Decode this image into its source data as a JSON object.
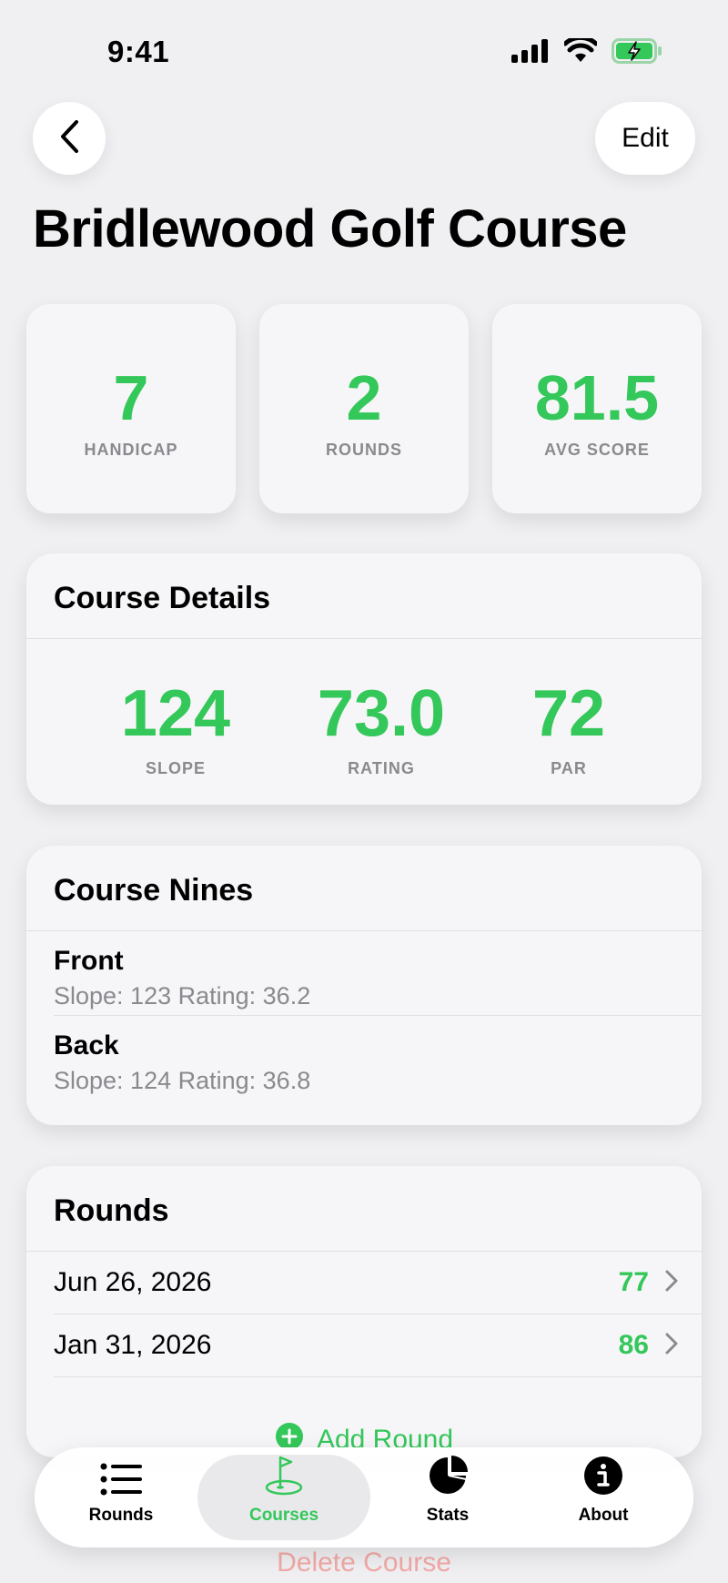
{
  "status_bar": {
    "time": "9:41"
  },
  "nav": {
    "edit_label": "Edit"
  },
  "course": {
    "name": "Bridlewood Golf Course"
  },
  "stats": [
    {
      "value": "7",
      "label": "HANDICAP"
    },
    {
      "value": "2",
      "label": "ROUNDS"
    },
    {
      "value": "81.5",
      "label": "AVG SCORE"
    }
  ],
  "details": {
    "title": "Course Details",
    "items": [
      {
        "value": "124",
        "label": "SLOPE"
      },
      {
        "value": "73.0",
        "label": "RATING"
      },
      {
        "value": "72",
        "label": "PAR"
      }
    ]
  },
  "nines": {
    "title": "Course Nines",
    "items": [
      {
        "name": "Front",
        "meta": "Slope: 123 Rating: 36.2"
      },
      {
        "name": "Back",
        "meta": "Slope: 124 Rating: 36.8"
      }
    ]
  },
  "rounds": {
    "title": "Rounds",
    "items": [
      {
        "date": "Jun 26, 2026",
        "score": "77"
      },
      {
        "date": "Jan 31, 2026",
        "score": "86"
      }
    ],
    "add_label": "Add Round"
  },
  "delete_label": "Delete Course",
  "tabs": [
    {
      "label": "Rounds",
      "icon": "list-icon",
      "active": false
    },
    {
      "label": "Courses",
      "icon": "flag-icon",
      "active": true
    },
    {
      "label": "Stats",
      "icon": "pie-chart-icon",
      "active": false
    },
    {
      "label": "About",
      "icon": "info-icon",
      "active": false
    }
  ],
  "colors": {
    "accent": "#34c759",
    "destructive": "#f3a9a6",
    "background": "#f0f0f3"
  }
}
